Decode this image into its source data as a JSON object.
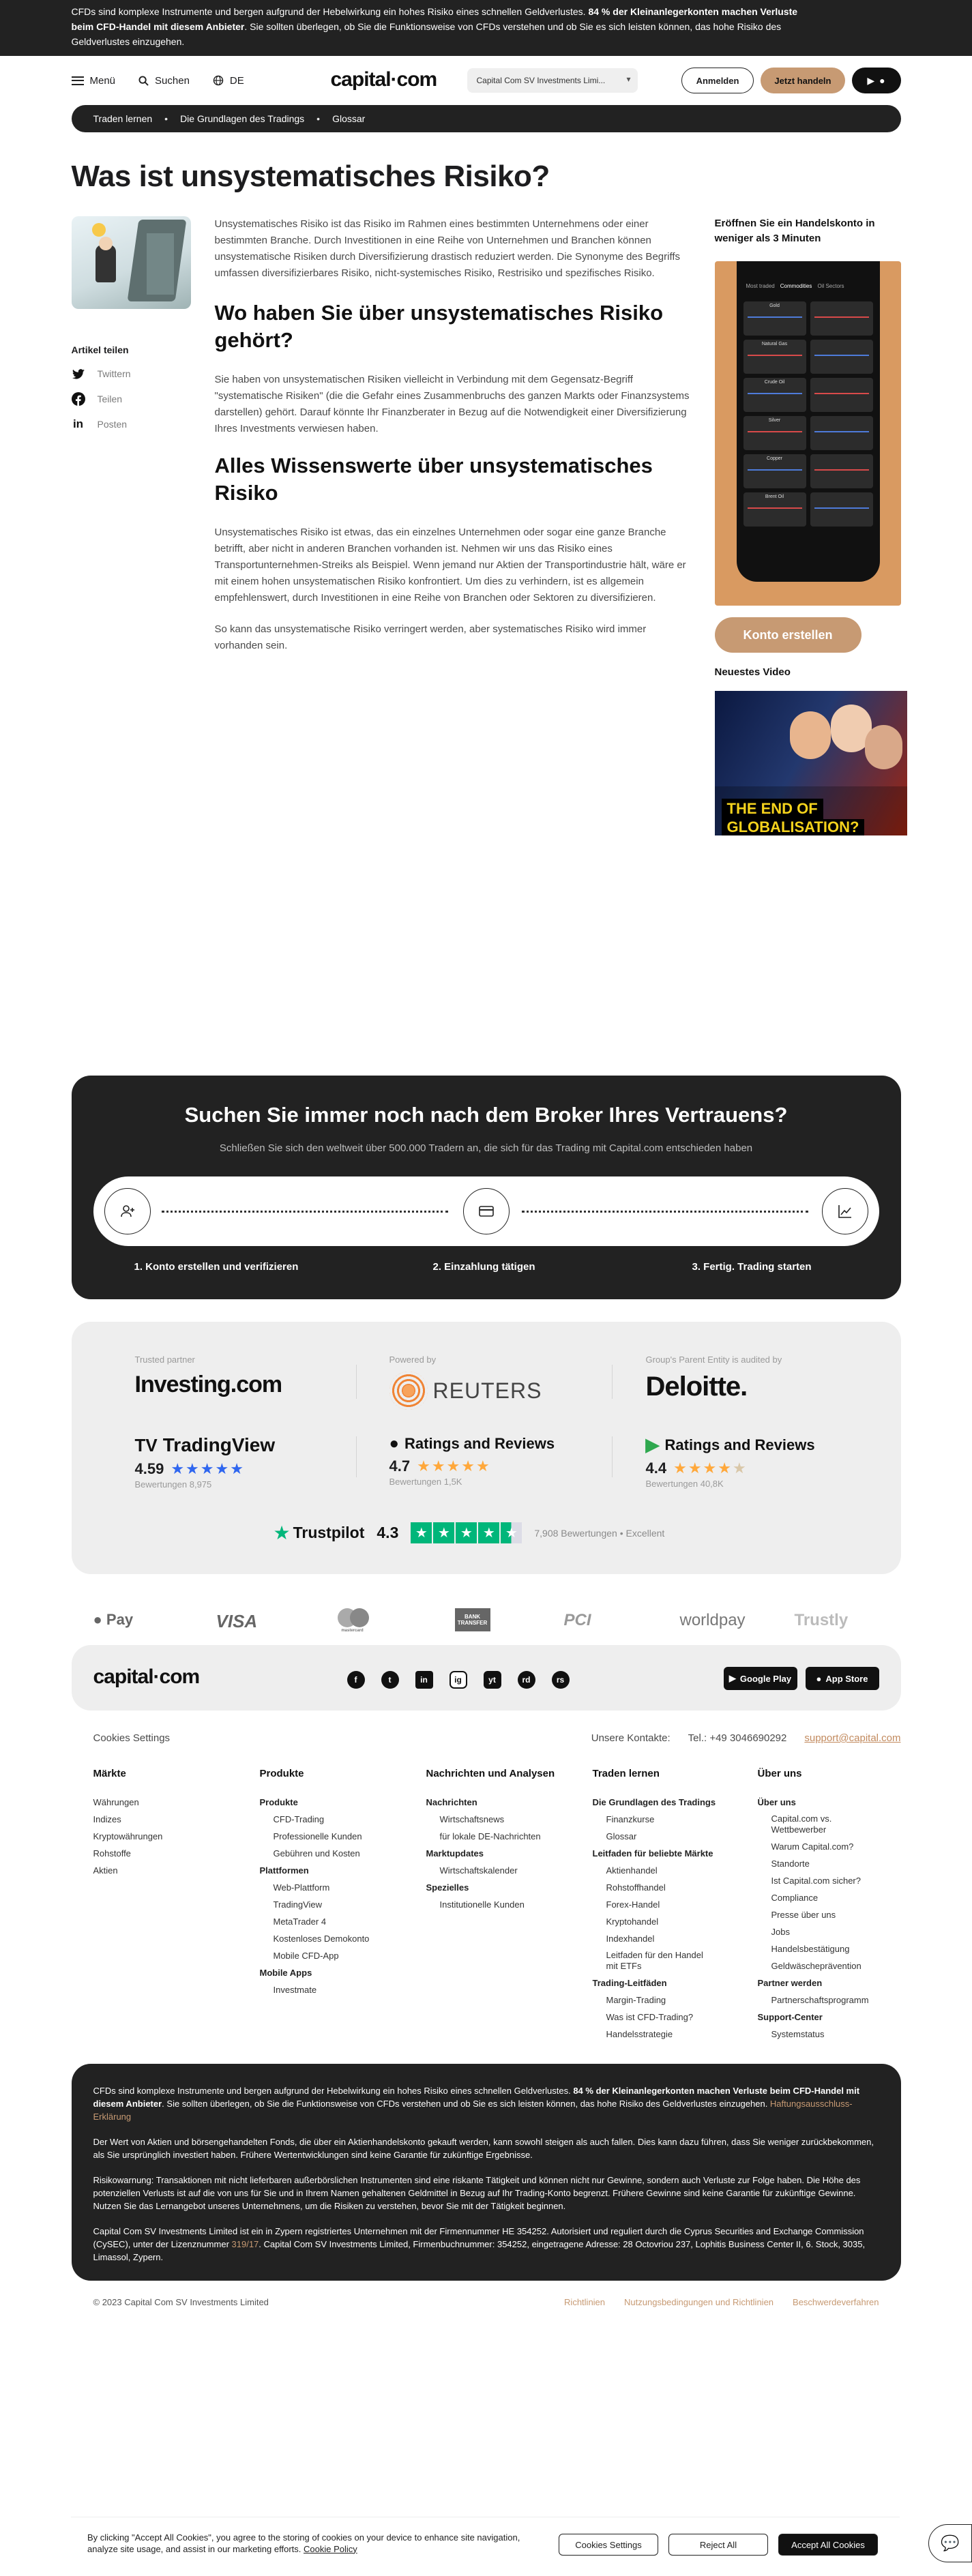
{
  "risk_banner": {
    "text_1": "CFDs sind komplexe Instrumente und bergen aufgrund der Hebelwirkung ein hohes Risiko eines schnellen Geldverlustes. ",
    "bold": "84 % der Kleinanlegerkonten machen Verluste beim CFD-Handel mit diesem Anbieter",
    "text_2": ". Sie sollten überlegen, ob Sie die Funktionsweise von CFDs verstehen und ob Sie es sich leisten können, das hohe Risiko des Geldverlustes einzugehen."
  },
  "header": {
    "menu_label": "Menü",
    "search_label": "Suchen",
    "lang_label": "DE",
    "logo": "capital·com",
    "entity_select": "Capital Com SV Investments Limi...",
    "login_label": "Anmelden",
    "trade_label": "Jetzt handeln"
  },
  "breadcrumb": [
    "Traden lernen",
    "Die Grundlagen des Tradings",
    "Glossar"
  ],
  "article": {
    "title": "Was ist unsystematisches Risiko?",
    "share_title": "Artikel teilen",
    "share": [
      "Twittern",
      "Teilen",
      "Posten"
    ],
    "p1": "Unsystematisches Risiko ist das Risiko im Rahmen eines bestimmten Unternehmens oder einer bestimmten Branche. Durch Investitionen in eine Reihe von Unternehmen und Branchen können unsystematische Risiken durch Diversifizierung drastisch reduziert werden. Die Synonyme des Begriffs umfassen diversifizierbares Risiko, nicht-systemisches Risiko, Restrisiko und spezifisches Risiko.",
    "h2a": "Wo haben Sie über unsystematisches Risiko gehört?",
    "p2": "Sie haben von unsystematischen Risiken vielleicht in Verbindung mit dem Gegensatz-Begriff \"systematische Risiken\" (die die Gefahr eines Zusammenbruchs des ganzen Markts oder Finanzsystems darstellen) gehört. Darauf könnte Ihr Finanzberater in Bezug auf die Notwendigkeit einer Diversifizierung Ihres Investments verwiesen haben.",
    "h2b": "Alles Wissenswerte über unsystematisches Risiko",
    "p3": "Unsystematisches Risiko ist etwas, das ein einzelnes Unternehmen oder sogar eine ganze Branche betrifft, aber nicht in anderen Branchen vorhanden ist. Nehmen wir uns das Risiko eines Transportunternehmen-Streiks als Beispiel. Wenn jemand nur Aktien der Transportindustrie hält, wäre er mit einem hohen unsystematischen Risiko konfrontiert. Um dies zu verhindern, ist es allgemein empfehlenswert, durch Investitionen in eine Reihe von Branchen oder Sektoren zu diversifizieren.",
    "p4": "So kann das unsystematische Risiko verringert werden, aber systematisches Risiko wird immer vorhanden sein."
  },
  "sidebar": {
    "account_title": "Eröffnen Sie ein Handelskonto in weniger als 3 Minuten",
    "phone_tabs": [
      "Most traded",
      "Commodities",
      "Oil Sectors"
    ],
    "phone_markets": [
      "Gold",
      "Natural Gas",
      "Crude Oil",
      "Silver",
      "Copper",
      "Brent Oil"
    ],
    "open_button": "Konto erstellen",
    "video_title": "Neuestes Video",
    "video_caption_1": "THE END OF",
    "video_caption_2": "GLOBALISATION?"
  },
  "broker": {
    "title": "Suchen Sie immer noch nach dem Broker Ihres Vertrauens?",
    "subtitle": "Schließen Sie sich den weltweit über 500.000 Tradern an, die sich für das Trading mit Capital.com entschieden haben",
    "steps": [
      "1. Konto erstellen und verifizieren",
      "2. Einzahlung tätigen",
      "3. Fertig. Trading starten"
    ]
  },
  "partners": {
    "trusted_label": "Trusted partner",
    "trusted_brand": "Investing.com",
    "powered_label": "Powered by",
    "powered_brand": "REUTERS",
    "audit_label": "Group's Parent Entity is audited by",
    "audit_brand": "Deloitte.",
    "reviews": [
      {
        "name": "TradingView",
        "score": "4.59",
        "count": "Bewertungen 8,975"
      },
      {
        "name": "Ratings and Reviews",
        "score": "4.7",
        "count": "Bewertungen 1,5K"
      },
      {
        "name": "Ratings and Reviews",
        "score": "4.4",
        "count": "Bewertungen 40,8K"
      }
    ],
    "trustpilot": {
      "name": "Trustpilot",
      "score": "4.3",
      "count": "7,908 Bewertungen",
      "label": "Excellent"
    }
  },
  "payments": [
    "Pay",
    "VISA",
    "mastercard",
    "BANK TRANSFER",
    "PCI",
    "worldpay",
    "Trustly"
  ],
  "footer": {
    "logo": "capital·com",
    "social": [
      "f",
      "t",
      "in",
      "ig",
      "yt",
      "rd",
      "rs"
    ],
    "google_play": "Google Play",
    "app_store": "App Store",
    "cookies_settings": "Cookies Settings",
    "contacts_label": "Unsere Kontakte:",
    "phone": "Tel.: +49 3046690292",
    "email": "support@capital.com",
    "columns": [
      {
        "title": "Märkte",
        "items": [
          "Währungen",
          "Indizes",
          "Kryptowährungen",
          "Rohstoffe",
          "Aktien"
        ]
      },
      {
        "title": "Produkte",
        "groups": [
          {
            "head": "Produkte",
            "items": [
              "CFD-Trading",
              "Professionelle Kunden",
              "Gebühren und Kosten"
            ]
          },
          {
            "head": "Plattformen",
            "items": [
              "Web-Plattform",
              "TradingView",
              "MetaTrader 4",
              "Kostenloses Demokonto",
              "Mobile CFD-App"
            ]
          },
          {
            "head": "Mobile Apps",
            "items": [
              "Investmate"
            ]
          }
        ]
      },
      {
        "title": "Nachrichten und Analysen",
        "groups": [
          {
            "head": "Nachrichten",
            "items": [
              "Wirtschaftsnews",
              "für lokale DE-Nachrichten"
            ]
          },
          {
            "head": "Marktupdates",
            "items": [
              "Wirtschaftskalender"
            ]
          },
          {
            "head": "Spezielles",
            "items": [
              "Institutionelle Kunden"
            ]
          }
        ]
      },
      {
        "title": "Traden lernen",
        "groups": [
          {
            "head": "Die Grundlagen des Tradings",
            "items": [
              "Finanzkurse",
              "Glossar"
            ]
          },
          {
            "head": "Leitfaden für beliebte Märkte",
            "items": [
              "Aktienhandel",
              "Rohstoffhandel",
              "Forex-Handel",
              "Kryptohandel",
              "Indexhandel",
              "Leitfaden für den Handel mit ETFs"
            ]
          },
          {
            "head": "Trading-Leitfäden",
            "items": [
              "Margin-Trading",
              "Was ist CFD-Trading?",
              "Handelsstrategie"
            ]
          }
        ]
      },
      {
        "title": "Über uns",
        "groups": [
          {
            "head": "Über uns",
            "items": [
              "Capital.com vs. Wettbewerber",
              "Warum Capital.com?",
              "Standorte",
              "Ist Capital.com sicher?",
              "Compliance",
              "Presse über uns",
              "Jobs",
              "Handelsbestätigung",
              "Geldwäscheprävention"
            ]
          },
          {
            "head": "Partner werden",
            "items": [
              "Partnerschaftsprogramm"
            ]
          },
          {
            "head": "Support-Center",
            "items": [
              "Systemstatus"
            ]
          }
        ]
      }
    ]
  },
  "disclaimer": {
    "p1_a": "CFDs sind komplexe Instrumente und bergen aufgrund der Hebelwirkung ein hohes Risiko eines schnellen Geldverlustes. ",
    "p1_bold": "84 % der Kleinanlegerkonten machen Verluste beim CFD-Handel mit diesem Anbieter",
    "p1_b": ". Sie sollten überlegen, ob Sie die Funktionsweise von CFDs verstehen und ob Sie es sich leisten können, das hohe Risiko des Geldverlustes einzugehen. ",
    "p1_link": "Haftungsausschluss-Erklärung",
    "p2": "Der Wert von Aktien und börsengehandelten Fonds, die über ein Aktienhandelskonto gekauft werden, kann sowohl steigen als auch fallen. Dies kann dazu führen, dass Sie weniger zurückbekommen, als Sie ursprünglich investiert haben. Frühere Wertentwicklungen sind keine Garantie für zukünftige Ergebnisse.",
    "p3": "Risikowarnung: Transaktionen mit nicht lieferbaren außerbörslichen Instrumenten sind eine riskante Tätigkeit und können nicht nur Gewinne, sondern auch Verluste zur Folge haben. Die Höhe des potenziellen Verlusts ist auf die von uns für Sie und in Ihrem Namen gehaltenen Geldmittel in Bezug auf Ihr Trading-Konto begrenzt. Frühere Gewinne sind keine Garantie für zukünftige Gewinne. Nutzen Sie das Lernangebot unseres Unternehmens, um die Risiken zu verstehen, bevor Sie mit der Tätigkeit beginnen.",
    "p4_a": "Capital Com SV Investments Limited ist ein in Zypern registriertes Unternehmen mit der Firmennummer HE 354252. Autorisiert und reguliert durch die Cyprus Securities and Exchange Commission (CySEC), unter der Lizenznummer ",
    "p4_link": "319/17",
    "p4_b": ". Capital Com SV Investments Limited, Firmenbuchnummer: 354252, eingetragene Adresse: 28 Octovriou 237, Lophitis Business Center II, 6. Stock, 3035, Limassol, Zypern."
  },
  "copyright": {
    "text": "© 2023 Capital Com SV Investments Limited",
    "links": [
      "Richtlinien",
      "Nutzungsbedingungen und Richtlinien",
      "Beschwerdeverfahren"
    ]
  },
  "cookie": {
    "text": "By clicking \"Accept All Cookies\", you agree to the storing of cookies on your device to enhance site navigation, analyze site usage, and assist in our marketing efforts. ",
    "link": "Cookie Policy",
    "settings": "Cookies Settings",
    "reject": "Reject All",
    "accept": "Accept All Cookies"
  }
}
